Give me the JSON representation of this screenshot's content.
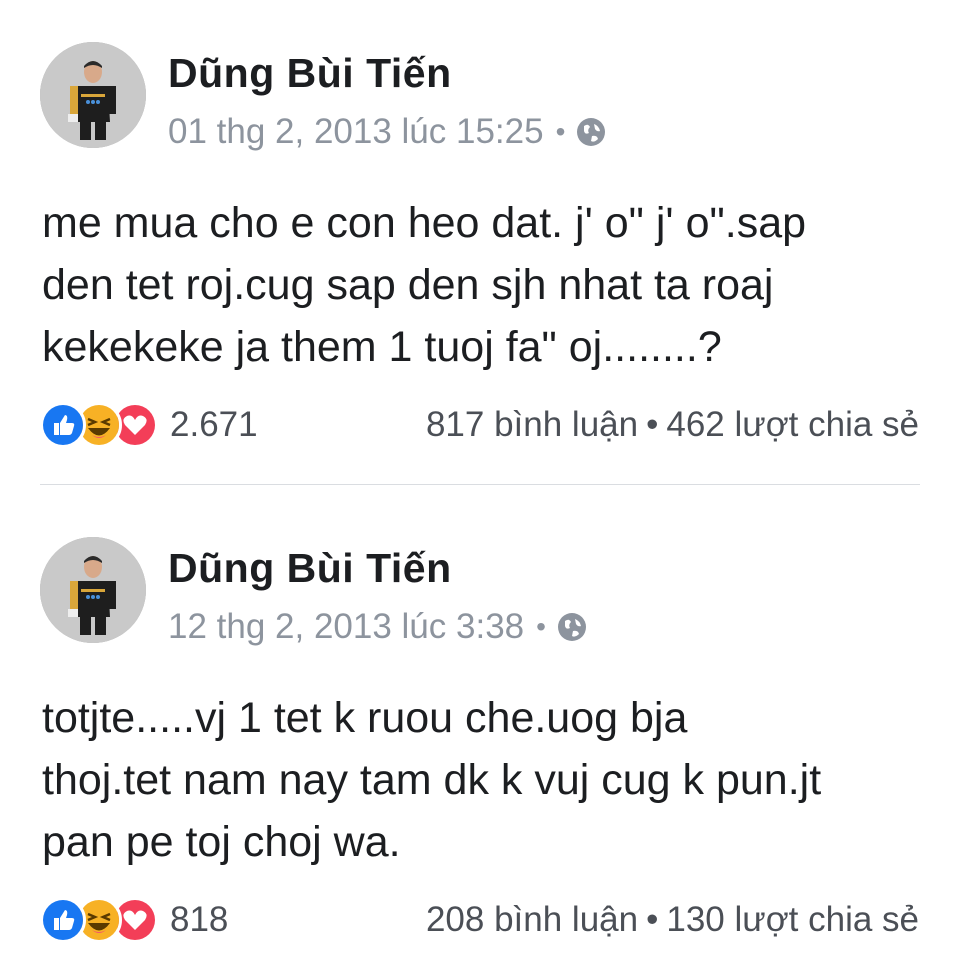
{
  "posts": [
    {
      "author": "Dũng Bùi Tiến",
      "timestamp": "01 thg 2, 2013 lúc 15:25",
      "meta_separator": "•",
      "privacy_icon": "globe-icon",
      "text_lines": [
        "me mua cho e con heo dat. j' o\" j' o\".sap",
        "den tet roj.cug sap den sjh nhat ta roaj",
        "kekekeke ja them 1 tuoj fa\" oj........?"
      ],
      "reaction_icons": [
        "like-icon",
        "haha-icon",
        "love-icon"
      ],
      "reaction_count": "2.671",
      "comments": "817 bình luận",
      "stats_separator": "•",
      "shares": "462 lượt chia sẻ"
    },
    {
      "author": "Dũng Bùi Tiến",
      "timestamp": "12 thg 2, 2013 lúc 3:38",
      "meta_separator": "•",
      "privacy_icon": "globe-icon",
      "text_lines": [
        "totjte.....vj 1 tet k ruou che.uog bja",
        "thoj.tet nam nay tam dk k vuj cug k pun.jt",
        "pan pe toj choj wa."
      ],
      "reaction_icons": [
        "like-icon",
        "haha-icon",
        "love-icon"
      ],
      "reaction_count": "818",
      "comments": "208 bình luận",
      "stats_separator": "•",
      "shares": "130 lượt chia sẻ"
    }
  ],
  "colors": {
    "text": "#1c1e21",
    "meta": "#8d949e",
    "like": "#1877f2",
    "haha": "#f7b125",
    "love": "#f33e58",
    "divider": "#dadde1"
  }
}
